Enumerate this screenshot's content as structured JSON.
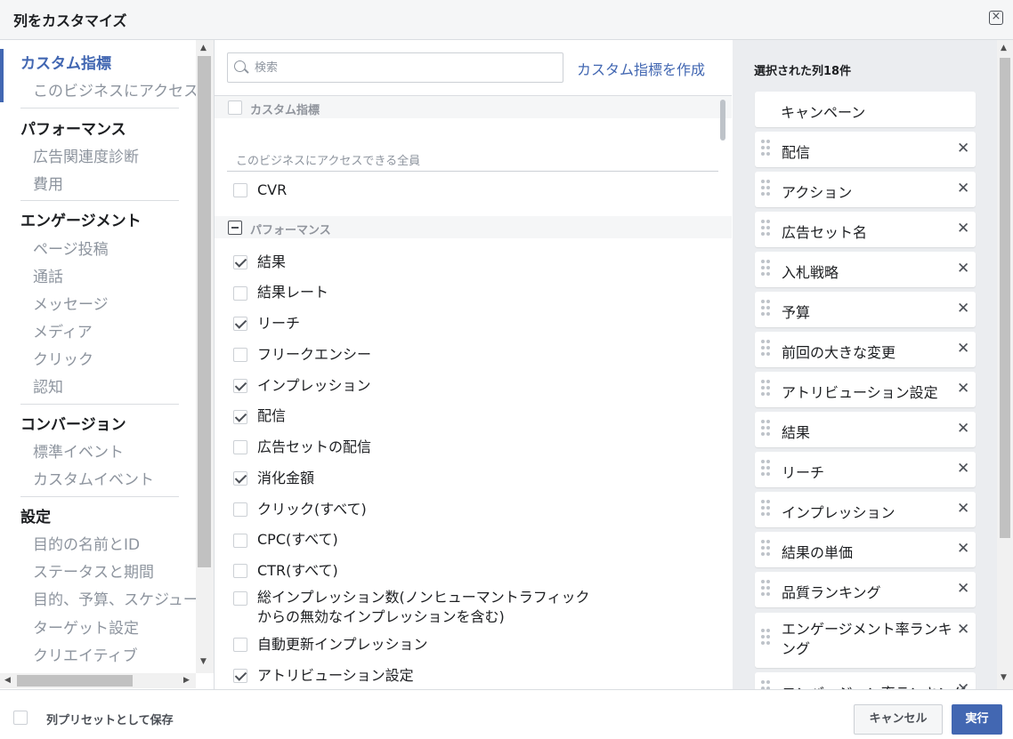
{
  "dialog": {
    "title": "列をカスタマイズ",
    "close_icon": "close-icon"
  },
  "nav": {
    "items": [
      {
        "label": "カスタム指標",
        "type": "category",
        "active": true
      },
      {
        "label": "このビジネスにアクセスできる全員",
        "type": "sub"
      },
      {
        "label": "パフォーマンス",
        "type": "category"
      },
      {
        "label": "広告関連度診断",
        "type": "sub"
      },
      {
        "label": "費用",
        "type": "sub"
      },
      {
        "label": "エンゲージメント",
        "type": "category"
      },
      {
        "label": "ページ投稿",
        "type": "sub"
      },
      {
        "label": "通話",
        "type": "sub"
      },
      {
        "label": "メッセージ",
        "type": "sub"
      },
      {
        "label": "メディア",
        "type": "sub"
      },
      {
        "label": "クリック",
        "type": "sub"
      },
      {
        "label": "認知",
        "type": "sub"
      },
      {
        "label": "コンバージョン",
        "type": "category"
      },
      {
        "label": "標準イベント",
        "type": "sub"
      },
      {
        "label": "カスタムイベント",
        "type": "sub"
      },
      {
        "label": "設定",
        "type": "category"
      },
      {
        "label": "目的の名前とID",
        "type": "sub"
      },
      {
        "label": "ステータスと期間",
        "type": "sub"
      },
      {
        "label": "目的、予算、スケジュール",
        "type": "sub"
      },
      {
        "label": "ターゲット設定",
        "type": "sub"
      },
      {
        "label": "クリエイティブ",
        "type": "sub"
      }
    ]
  },
  "search": {
    "placeholder": "検索",
    "value": ""
  },
  "create_custom_metric": "カスタム指標を作成",
  "custom_metrics_section": {
    "header": "カスタム指標",
    "group_label": "このビジネスにアクセスできる全員",
    "items": [
      {
        "label": "CVR",
        "checked": false
      }
    ]
  },
  "performance_section": {
    "header": "パフォーマンス",
    "items": [
      {
        "label": "結果",
        "checked": true
      },
      {
        "label": "結果レート",
        "checked": false
      },
      {
        "label": "リーチ",
        "checked": true
      },
      {
        "label": "フリークエンシー",
        "checked": false
      },
      {
        "label": "インプレッション",
        "checked": true
      },
      {
        "label": "配信",
        "checked": true
      },
      {
        "label": "広告セットの配信",
        "checked": false
      },
      {
        "label": "消化金額",
        "checked": true
      },
      {
        "label": "クリック(すべて)",
        "checked": false
      },
      {
        "label": "CPC(すべて)",
        "checked": false
      },
      {
        "label": "CTR(すべて)",
        "checked": false
      },
      {
        "label": "総インプレッション数(ノンヒューマントラフィックからの無効なインプレッションを含む)",
        "label_line1": "総インプレッション数(ノンヒューマントラフィック",
        "label_line2": "からの無効なインプレッションを含む)",
        "checked": false
      },
      {
        "label": "自動更新インプレッション",
        "checked": false
      },
      {
        "label": "アトリビューション設定",
        "checked": true
      }
    ]
  },
  "selected": {
    "title": "選択された列18件",
    "columns": [
      "キャンペーン",
      "配信",
      "アクション",
      "広告セット名",
      "入札戦略",
      "予算",
      "前回の大きな変更",
      "アトリビューション設定",
      "結果",
      "リーチ",
      "インプレッション",
      "結果の単価",
      "品質ランキング",
      "エンゲージメント率ランキング",
      "コンバージョン率ランキング"
    ]
  },
  "footer": {
    "save_preset_label": "列プリセットとして保存",
    "save_preset_checked": false,
    "cancel_label": "キャンセル",
    "run_label": "実行"
  },
  "colors": {
    "accent": "#4267b2",
    "panel_bg": "#ebedf0",
    "header_bg": "#f5f6f7"
  }
}
